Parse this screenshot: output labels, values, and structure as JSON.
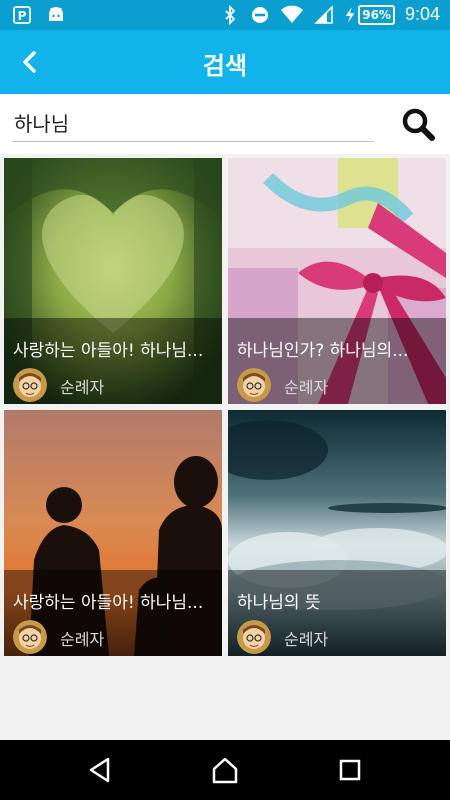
{
  "status_bar": {
    "time": "9:04",
    "battery": "96%",
    "icons": [
      "parking-icon",
      "android-icon",
      "bluetooth-icon",
      "do-not-disturb-icon",
      "wifi-icon",
      "signal-icon",
      "charging-icon",
      "battery-icon"
    ]
  },
  "app_bar": {
    "title": "검색",
    "back_icon": "back-arrow-icon"
  },
  "search": {
    "value": "하나님",
    "button_icon": "search-icon"
  },
  "results": [
    {
      "title": "사랑하는 아들아! 하나님...",
      "author": "순례자",
      "image": "green-heart-hedge"
    },
    {
      "title": "하나님인가? 하나님의...",
      "author": "순례자",
      "image": "pink-ribbon-gift"
    },
    {
      "title": "사랑하는 아들아! 하나님...",
      "author": "순례자",
      "image": "father-son-sunset-silhouette"
    },
    {
      "title": "하나님의 뜻",
      "author": "순례자",
      "image": "cloudy-sky"
    }
  ],
  "nav_bar": {
    "icons": [
      "back-triangle-icon",
      "home-icon",
      "recents-square-icon"
    ]
  }
}
